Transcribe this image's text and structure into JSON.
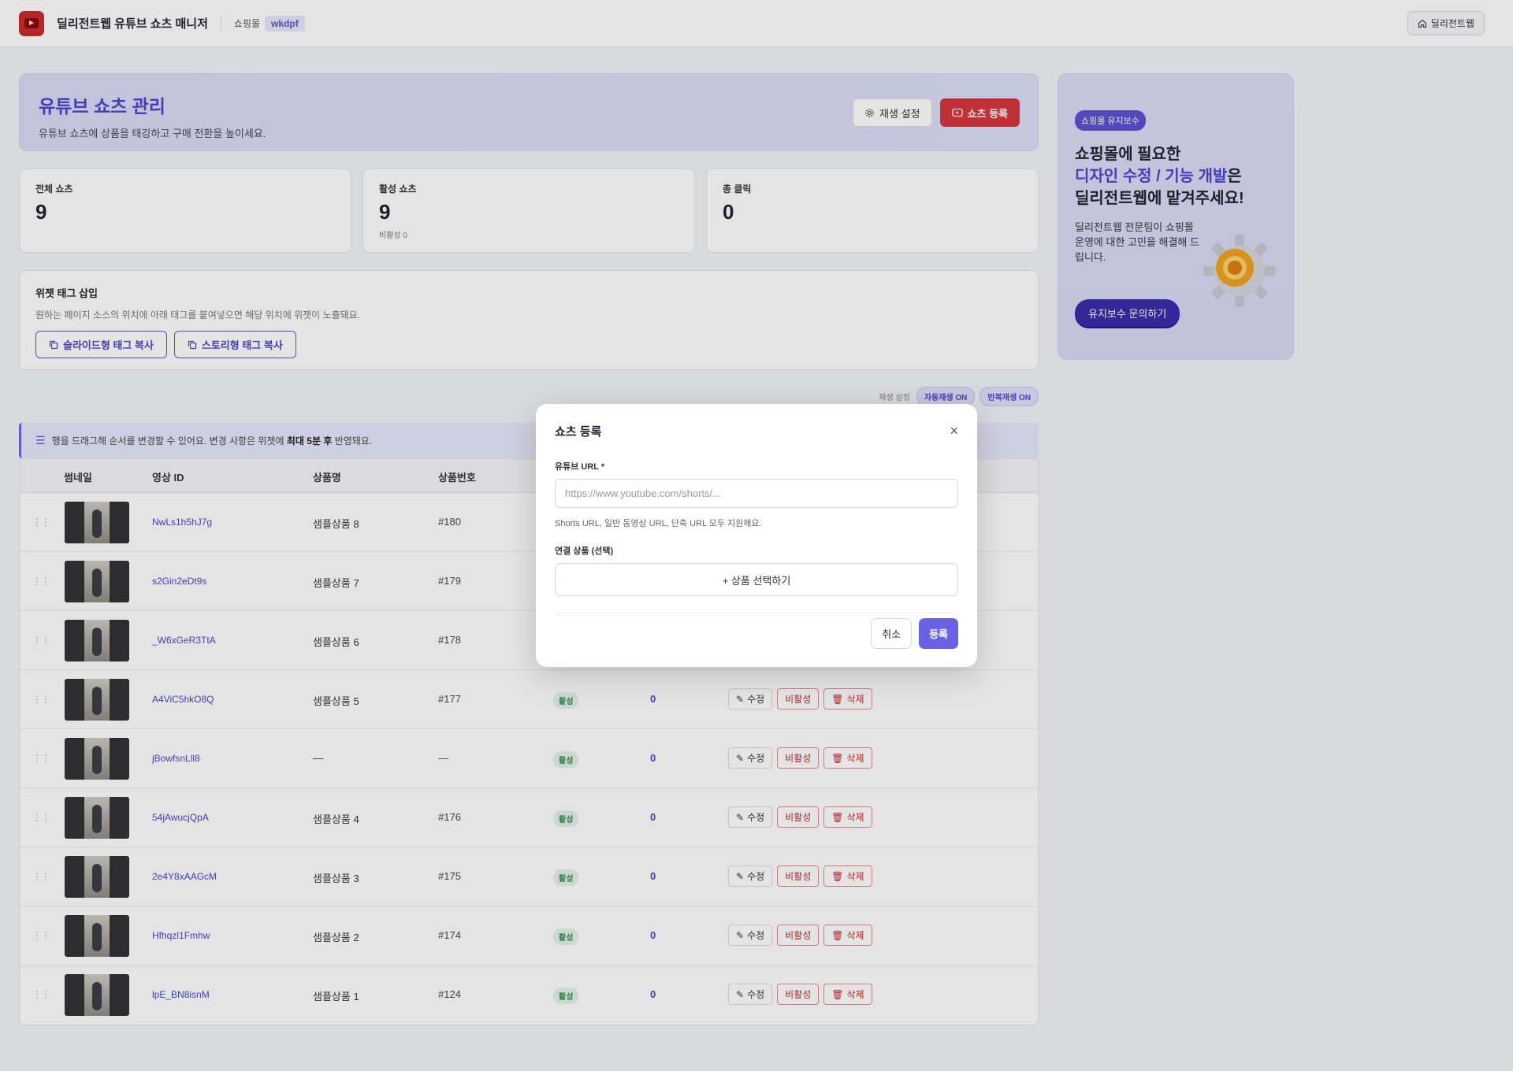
{
  "header": {
    "app_title": "딜리전트웹 유튜브 쇼츠 매니저",
    "mall_label": "쇼핑몰",
    "mall_id": "wkdpf",
    "home_label": "딜리전트웹"
  },
  "hero": {
    "title": "유튜브 쇼츠 관리",
    "subtitle": "유튜브 쇼츠에 상품을 태깅하고 구매 전환을 높이세요.",
    "settings_label": "재생 설정",
    "register_label": "쇼츠 등록"
  },
  "stats": [
    {
      "label": "전체 쇼츠",
      "value": "9",
      "sub": ""
    },
    {
      "label": "활성 쇼츠",
      "value": "9",
      "sub": "비활성 0"
    },
    {
      "label": "총 클릭",
      "value": "0",
      "sub": ""
    }
  ],
  "widget": {
    "title": "위젯 태그 삽입",
    "desc": "원하는 페이지 소스의 위치에 아래 태그를 붙여넣으면 해당 위치에 위젯이 노출돼요.",
    "slide_btn": "슬라이드형 태그 복사",
    "story_btn": "스토리형 태그 복사"
  },
  "playback": {
    "label": "재생 설정",
    "autoplay": "자동재생 ON",
    "loop": "반복재생 ON"
  },
  "notice": {
    "pre": "행을 드래그해 순서를 변경할 수 있어요. 변경 사항은 위젯에",
    "bold": "최대 5분 후",
    "post": "반영돼요."
  },
  "table": {
    "headers": {
      "thumb": "썸네일",
      "video_id": "영상 ID",
      "product": "상품명",
      "product_no": "상품번호"
    },
    "action_labels": {
      "edit": "수정",
      "deactivate": "비활성",
      "delete": "삭제"
    },
    "rows": [
      {
        "video_id": "NwLs1h5hJ7g",
        "product": "샘플상품 8",
        "no": "#180",
        "status": "",
        "clicks": ""
      },
      {
        "video_id": "s2Gin2eDt9s",
        "product": "샘플상품 7",
        "no": "#179",
        "status": "",
        "clicks": ""
      },
      {
        "video_id": "_W6xGeR3TtA",
        "product": "샘플상품 6",
        "no": "#178",
        "status": "",
        "clicks": ""
      },
      {
        "video_id": "A4ViC5hkO8Q",
        "product": "샘플상품 5",
        "no": "#177",
        "status": "활성",
        "clicks": "0"
      },
      {
        "video_id": "jBowfsnLll8",
        "product": "—",
        "no": "—",
        "status": "활성",
        "clicks": "0"
      },
      {
        "video_id": "54jAwucjQpA",
        "product": "샘플상품 4",
        "no": "#176",
        "status": "활성",
        "clicks": "0"
      },
      {
        "video_id": "2e4Y8xAAGcM",
        "product": "샘플상품 3",
        "no": "#175",
        "status": "활성",
        "clicks": "0"
      },
      {
        "video_id": "Hfhqzl1Fmhw",
        "product": "샘플상품 2",
        "no": "#174",
        "status": "활성",
        "clicks": "0"
      },
      {
        "video_id": "lpE_BN8isnM",
        "product": "샘플상품 1",
        "no": "#124",
        "status": "활성",
        "clicks": "0"
      }
    ]
  },
  "aside": {
    "badge": "쇼핑몰 유지보수",
    "line1": "쇼핑몰에 필요한",
    "line2_hl": "디자인 수정 / 기능 개발",
    "line2_tail": "은",
    "line3": "딜리전트웹에 맡겨주세요!",
    "desc": "딜리전트웹 전문팀이 쇼핑몰 운영에 대한 고민을 해결해 드립니다.",
    "cta": "유지보수 문의하기"
  },
  "modal": {
    "title": "쇼츠 등록",
    "url_label": "유튜브 URL *",
    "url_placeholder": "https://www.youtube.com/shorts/...",
    "url_value": "",
    "url_help": "Shorts URL, 일반 동영상 URL, 단축 URL 모두 지원해요.",
    "product_label": "연결 상품 (선택)",
    "pick_label": "+ 상품 선택하기",
    "cancel": "취소",
    "submit": "등록"
  },
  "colors": {
    "accent": "#5a4fcf",
    "danger": "#d6333a",
    "success": "#2f8a45"
  }
}
